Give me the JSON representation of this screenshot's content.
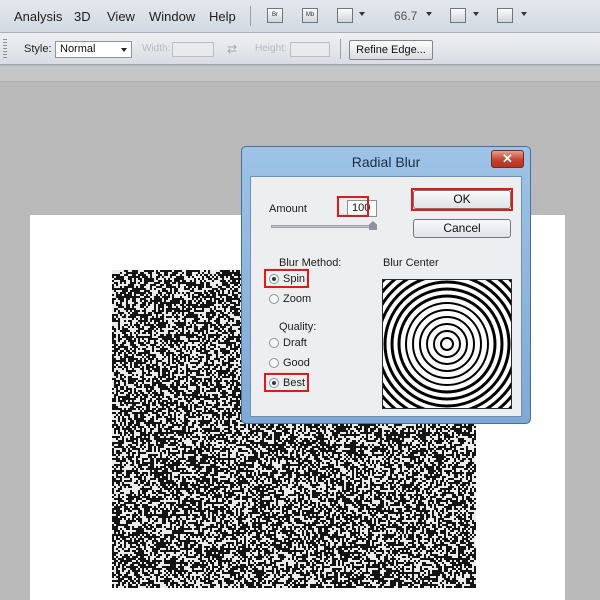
{
  "menu": {
    "items": [
      "Analysis",
      "3D",
      "View",
      "Window",
      "Help"
    ],
    "buttons": [
      "Br",
      "Mb"
    ],
    "zoom": "66.7"
  },
  "options": {
    "style_label": "Style:",
    "style_value": "Normal",
    "width_label": "Width:",
    "height_label": "Height:",
    "refine_edge": "Refine Edge..."
  },
  "dialog": {
    "title": "Radial Blur",
    "close": "✕",
    "amount_label": "Amount",
    "amount_value": "100",
    "amount_level": 1.0,
    "ok": "OK",
    "cancel": "Cancel",
    "blur_method_label": "Blur Method:",
    "methods": [
      {
        "label": "Spin",
        "selected": true
      },
      {
        "label": "Zoom",
        "selected": false
      }
    ],
    "quality_label": "Quality:",
    "qualities": [
      {
        "label": "Draft",
        "selected": false
      },
      {
        "label": "Good",
        "selected": false
      },
      {
        "label": "Best",
        "selected": true
      }
    ],
    "blur_center_label": "Blur Center"
  },
  "colors": {
    "highlight": "#e01919",
    "dialog_frame": "#8fb6df"
  }
}
